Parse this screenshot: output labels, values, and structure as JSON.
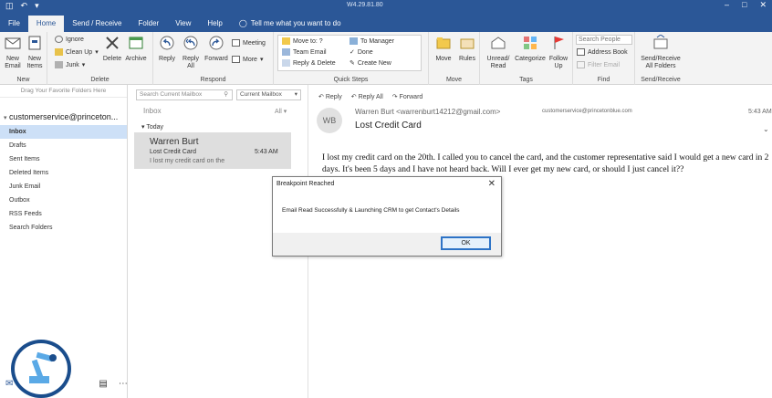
{
  "titlebar": {
    "window_title": "W4.29.81.80"
  },
  "ribbon_tabs": [
    "File",
    "Home",
    "Send / Receive",
    "Folder",
    "View",
    "Help"
  ],
  "tell_me": "Tell me what you want to do",
  "ribbon": {
    "new_email": "New\nEmail",
    "new_items": "New\nItems",
    "ignore": "Ignore",
    "clean_up": "Clean Up",
    "junk": "Junk",
    "delete": "Delete",
    "archive": "Archive",
    "reply": "Reply",
    "reply_all": "Reply\nAll",
    "forward": "Forward",
    "meeting": "Meeting",
    "more": "More",
    "qs_move_to": "Move to: ?",
    "qs_team_email": "Team Email",
    "qs_reply_delete": "Reply & Delete",
    "qs_to_manager": "To Manager",
    "qs_done": "Done",
    "qs_create_new": "Create New",
    "move": "Move",
    "rules": "Rules",
    "unread_read": "Unread/\nRead",
    "categorize": "Categorize",
    "follow_up": "Follow\nUp",
    "search_people": "Search People",
    "address_book": "Address Book",
    "filter_email": "Filter Email",
    "send_receive_all": "Send/Receive\nAll Folders",
    "groups": {
      "new": "New",
      "delete": "Delete",
      "respond": "Respond",
      "quick_steps": "Quick Steps",
      "move": "Move",
      "tags": "Tags",
      "find": "Find",
      "send_receive": "Send/Receive"
    }
  },
  "folder_pane": {
    "favorites_hint": "Drag Your Favorite Folders Here",
    "account": "customerservice@princeton...",
    "folders": [
      "Inbox",
      "Drafts",
      "Sent Items",
      "Deleted Items",
      "Junk Email",
      "Outbox",
      "RSS Feeds",
      "Search Folders"
    ]
  },
  "message_list": {
    "search_placeholder": "Search Current Mailbox",
    "scope": "Current Mailbox",
    "folder_label": "Inbox",
    "filter": "All",
    "group_header": "Today",
    "items": [
      {
        "from": "Warren Burt",
        "subject": "Lost Credit Card",
        "preview": "I lost my credit card on the",
        "time": "5:43 AM"
      }
    ]
  },
  "reading_pane": {
    "actions": [
      "Reply",
      "Reply All",
      "Forward"
    ],
    "avatar_initials": "WB",
    "sender": "Warren Burt <warrenburt14212@gmail.com>",
    "to": "customerservice@princetonblue.com",
    "time": "5:43 AM",
    "subject": "Lost Credit Card",
    "body": "I lost my credit card on the 20th. I called you to cancel the card, and the customer representative said I would get a new card in 2 days. It's been 5 days and I have not heard back. Will I ever get my new card, or should I just cancel it??"
  },
  "dialog": {
    "title": "Breakpoint Reached",
    "message": "Email Read Successfully & Launching CRM to get Contact's Details",
    "ok": "OK"
  },
  "colors": {
    "accent": "#2b5797",
    "selected": "#cde0f7",
    "mail_selected": "#dedede"
  }
}
